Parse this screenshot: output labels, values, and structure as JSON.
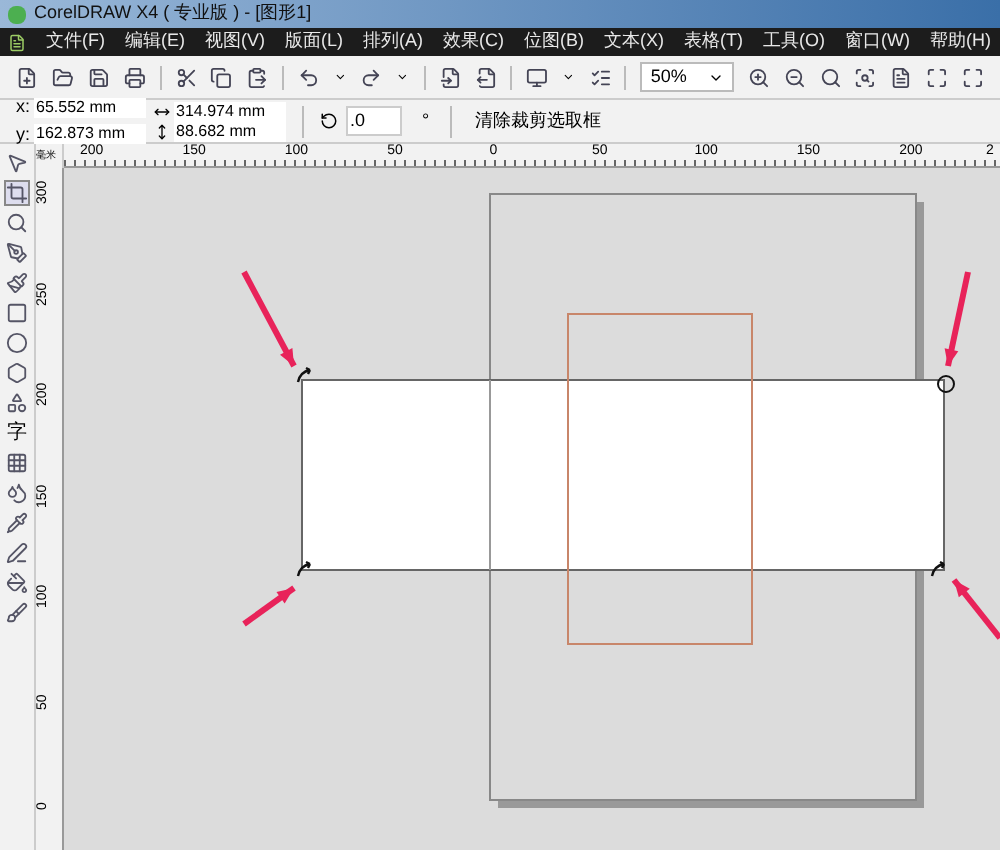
{
  "window": {
    "title": "CorelDRAW X4 ( 专业版 ) - [图形1]"
  },
  "menu": [
    "文件(F)",
    "编辑(E)",
    "视图(V)",
    "版面(L)",
    "排列(A)",
    "效果(C)",
    "位图(B)",
    "文本(X)",
    "表格(T)",
    "工具(O)",
    "窗口(W)",
    "帮助(H)"
  ],
  "toolbar": {
    "zoom": "50%"
  },
  "property_bar": {
    "x_label": "x:",
    "x": "65.552 mm",
    "y_label": "y:",
    "y": "162.873 mm",
    "width": "314.974 mm",
    "height": "88.682 mm",
    "angle": ".0",
    "angle_unit": "°",
    "clear_crop_button": "清除裁剪选取框"
  },
  "toolbox": {
    "text_tool": "字"
  },
  "top_ruler": {
    "unit": "毫米",
    "labels": [
      "200",
      "150",
      "100",
      "50",
      "0",
      "50",
      "100",
      "150",
      "200",
      "2"
    ]
  },
  "left_ruler": {
    "labels": [
      "300",
      "250",
      "200",
      "150",
      "100",
      "50",
      "0"
    ]
  }
}
